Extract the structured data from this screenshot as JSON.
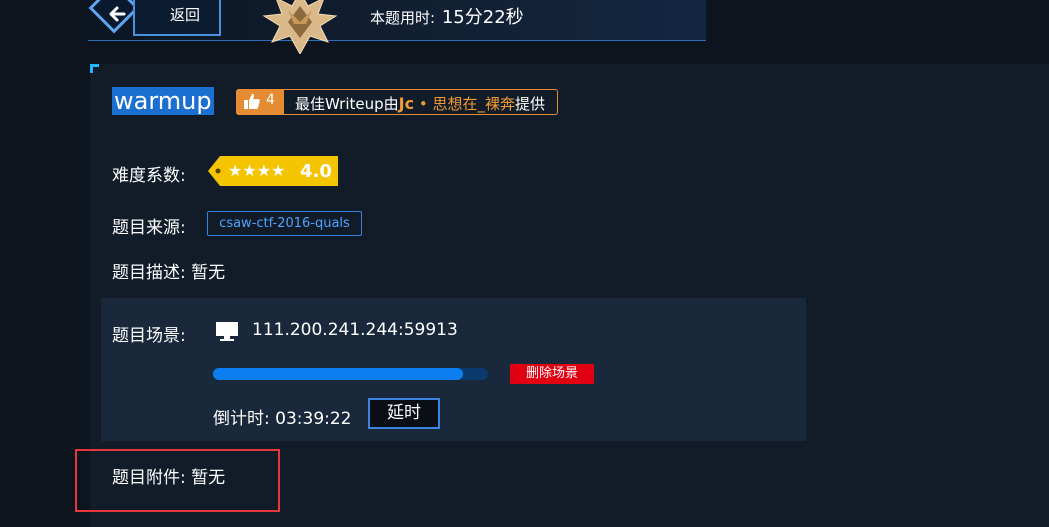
{
  "header": {
    "back_label": "返回",
    "timer_label": "本题用时:",
    "timer_value": "15分22秒"
  },
  "challenge": {
    "title": "warmup",
    "likes": "4",
    "writeup_prefix": "最佳Writeup由",
    "writeup_author": "Jc",
    "writeup_sep": " • ",
    "writeup_name": "思想在_裸奔",
    "writeup_suffix": "提供",
    "difficulty_label": "难度系数:",
    "difficulty_value": "4.0",
    "difficulty_stars": 4,
    "source_label": "题目来源:",
    "source_tag": "csaw-ctf-2016-quals",
    "desc_label": "题目描述:",
    "desc_value": "暂无"
  },
  "scene": {
    "label": "题目场景:",
    "address": "111.200.241.244:59913",
    "progress_fraction": 0.91,
    "delete_label": "删除场景",
    "countdown_label": "倒计时:",
    "countdown_value": "03:39:22",
    "extend_label": "延时"
  },
  "attachment": {
    "label": "题目附件:",
    "value": "暂无"
  },
  "colors": {
    "accent_blue": "#1a6fd0",
    "writeup_orange": "#e48b33",
    "difficulty_yellow": "#f5c400",
    "delete_red": "#e00012",
    "highlight_red": "#e5383d"
  }
}
